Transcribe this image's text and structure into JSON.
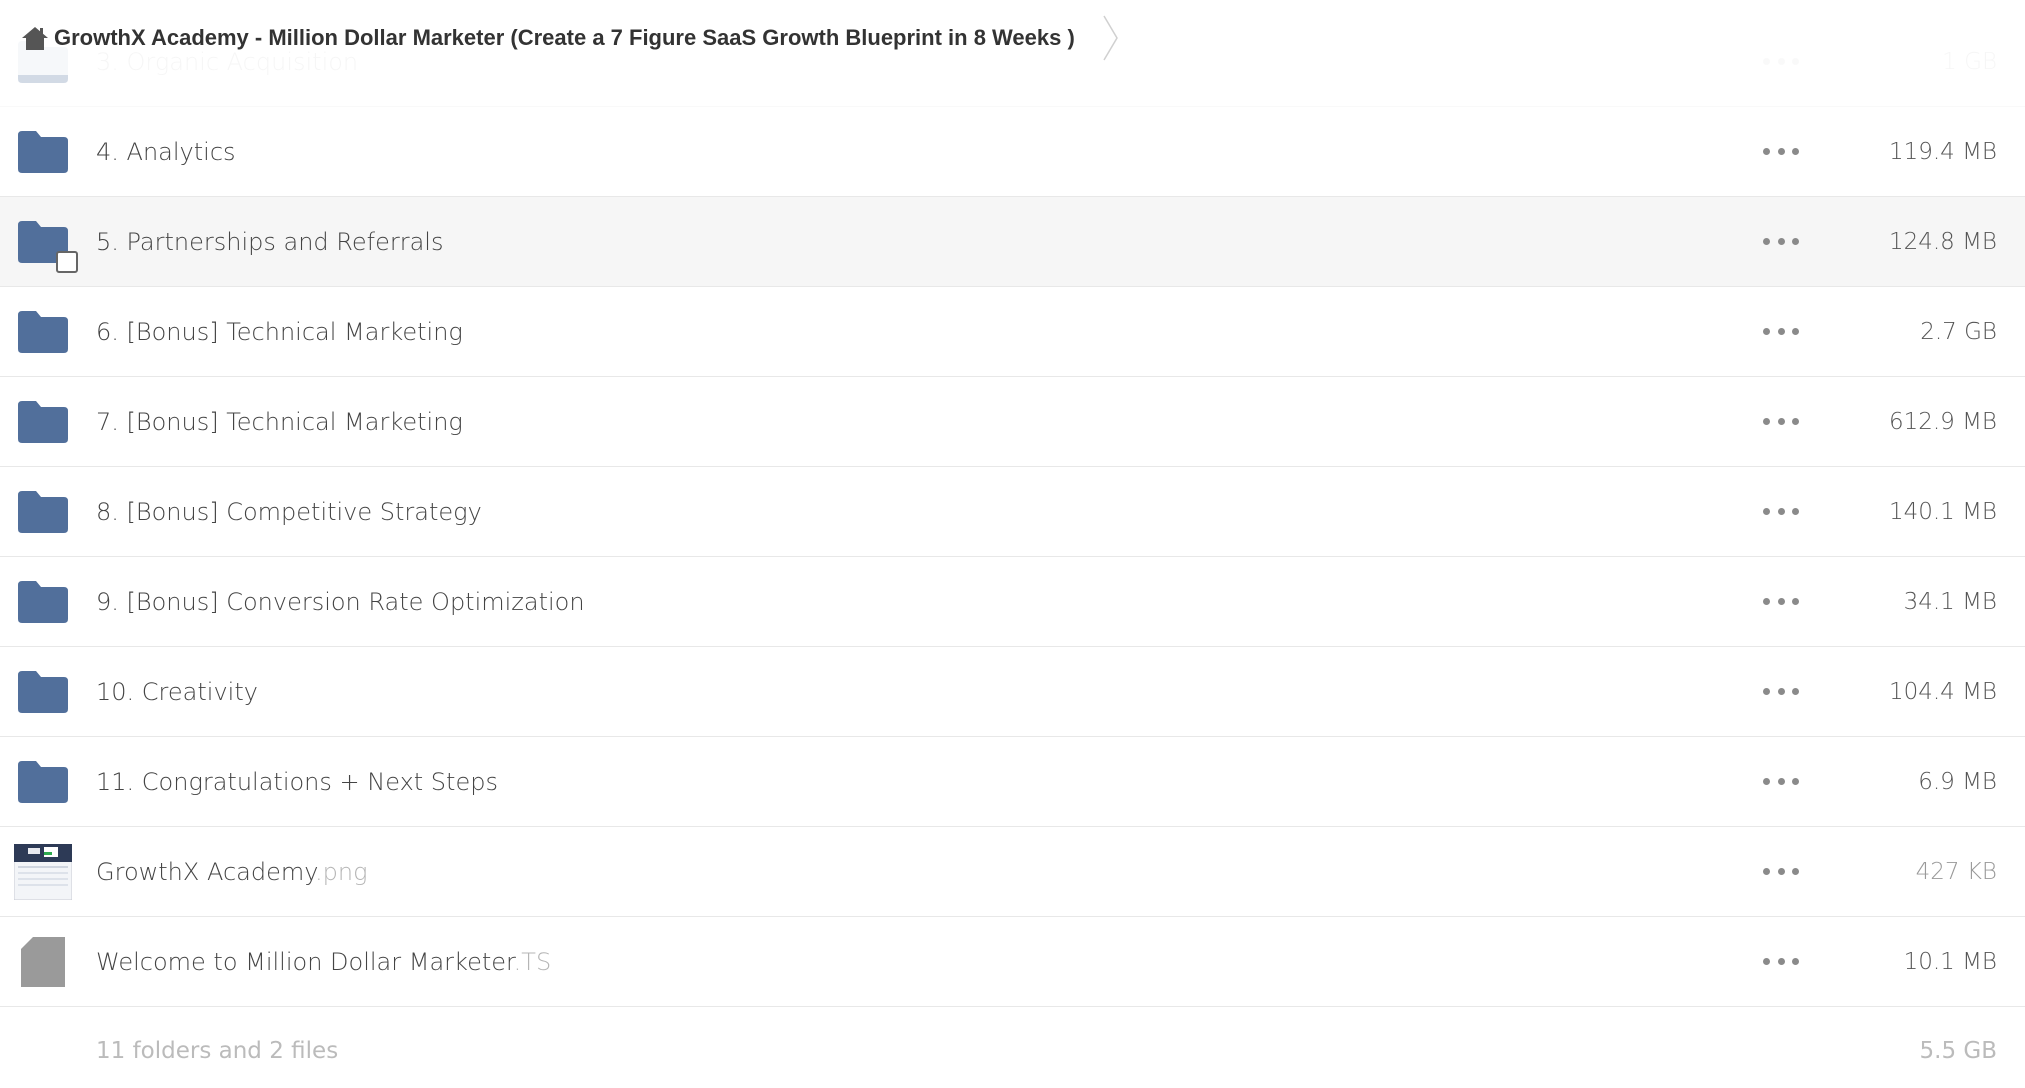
{
  "breadcrumb": {
    "title": "GrowthX Academy -  Million Dollar Marketer (Create a 7 Figure SaaS Growth Blueprint in 8 Weeks )",
    "home_icon": "home-icon",
    "separator_icon": "chevron-right-icon"
  },
  "colors": {
    "folder": "#516f9b",
    "generic_file": "#9a9a9a",
    "hover_row": "#f6f6f6"
  },
  "items": [
    {
      "name": "3. Organic Acquisition",
      "ext": "",
      "size": "1 GB",
      "type": "folder"
    },
    {
      "name": "4. Analytics",
      "ext": "",
      "size": "119.4 MB",
      "type": "folder"
    },
    {
      "name": "5. Partnerships and Referrals",
      "ext": "",
      "size": "124.8 MB",
      "type": "folder"
    },
    {
      "name": "6. [Bonus] Technical Marketing",
      "ext": "",
      "size": "2.7 GB",
      "type": "folder"
    },
    {
      "name": "7. [Bonus] Technical Marketing",
      "ext": "",
      "size": "612.9 MB",
      "type": "folder"
    },
    {
      "name": "8. [Bonus] Competitive Strategy",
      "ext": "",
      "size": "140.1 MB",
      "type": "folder"
    },
    {
      "name": "9. [Bonus] Conversion Rate Optimization",
      "ext": "",
      "size": "34.1 MB",
      "type": "folder"
    },
    {
      "name": "10. Creativity",
      "ext": "",
      "size": "104.4 MB",
      "type": "folder"
    },
    {
      "name": "11. Congratulations + Next Steps",
      "ext": "",
      "size": "6.9 MB",
      "type": "folder"
    },
    {
      "name": "GrowthX Academy",
      "ext": ".png",
      "size": "427 KB",
      "type": "image"
    },
    {
      "name": "Welcome to Million Dollar Marketer",
      "ext": ".TS",
      "size": "10.1 MB",
      "type": "file"
    }
  ],
  "summary": {
    "count": "11 folders and 2 files",
    "total": "5.5 GB"
  }
}
